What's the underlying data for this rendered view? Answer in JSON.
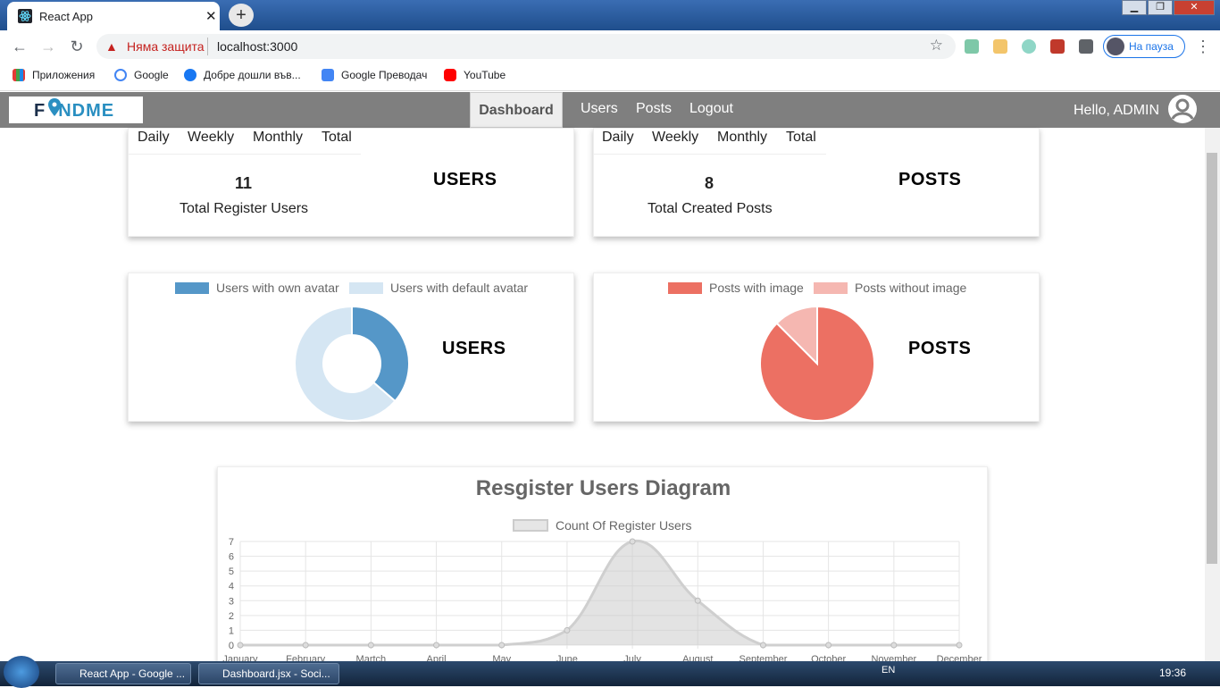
{
  "browser": {
    "tab_title": "React App",
    "tab_close": "✕",
    "new_tab": "+",
    "insecure_label": "Няма защита",
    "url": "localhost:3000",
    "profile_label": "На пауза",
    "bookmarks": [
      "Приложения",
      "Google",
      "Добре дошли във...",
      "Google Преводач",
      "YouTube"
    ]
  },
  "navbar": {
    "logo_text_a": "F",
    "logo_text_b": "NDME",
    "links": [
      "Dashboard",
      "Users",
      "Posts",
      "Logout"
    ],
    "active": "Dashboard",
    "greeting": "Hello, ADMIN"
  },
  "cards": {
    "users_stats": {
      "periods": [
        "Daily",
        "Weekly",
        "Monthly",
        "Total"
      ],
      "value": "11",
      "caption": "Total Register Users",
      "heading": "USERS"
    },
    "posts_stats": {
      "periods": [
        "Daily",
        "Weekly",
        "Monthly",
        "Total"
      ],
      "value": "8",
      "caption": "Total Created Posts",
      "heading": "POSTS"
    },
    "users_avatar": {
      "heading": "USERS",
      "legend": [
        "Users with own avatar",
        "Users with default avatar"
      ]
    },
    "posts_image": {
      "heading": "POSTS",
      "legend": [
        "Posts with image",
        "Posts without image"
      ]
    }
  },
  "chart_data": [
    {
      "type": "pie",
      "variant": "doughnut",
      "labels": [
        "Users with own avatar",
        "Users with default avatar"
      ],
      "values": [
        4,
        7
      ],
      "colors": [
        "#5597c8",
        "#d5e6f3"
      ]
    },
    {
      "type": "pie",
      "labels": [
        "Posts with image",
        "Posts without image"
      ],
      "values": [
        7,
        1
      ],
      "colors": [
        "#ec7063",
        "#f5b7b1"
      ]
    },
    {
      "type": "area",
      "title": "Resgister Users Diagram",
      "categories": [
        "January",
        "February",
        "Martch",
        "April",
        "May",
        "June",
        "July",
        "August",
        "September",
        "October",
        "November",
        "December"
      ],
      "series": [
        {
          "name": "Count Of Register Users",
          "values": [
            0,
            0,
            0,
            0,
            0,
            1,
            7,
            3,
            0,
            0,
            0,
            0
          ]
        }
      ],
      "ylim": [
        0,
        7
      ],
      "yticks": [
        0,
        1,
        2,
        3,
        4,
        5,
        6,
        7
      ],
      "grid": true,
      "legend": "top"
    }
  ],
  "taskbar": {
    "items": [
      "React App - Google ...",
      "Dashboard.jsx - Soci..."
    ],
    "lang": "EN",
    "clock": "19:36"
  },
  "colors": {
    "navbar_bg": "#7f7f7f",
    "own_avatar": "#5597c8",
    "default_avatar": "#d5e6f3",
    "with_image": "#ec7063",
    "without_image": "#f5b7b1"
  }
}
